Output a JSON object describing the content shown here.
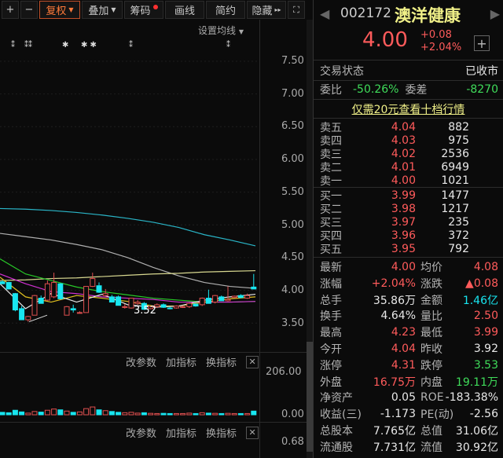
{
  "toolbar": {
    "plus": "+",
    "minus": "−",
    "fuquan": "复权",
    "diejia": "叠加",
    "chouma": "筹码",
    "huaxian": "画线",
    "jianyue": "简约",
    "yincang": "隐藏",
    "set_ma": "设置均线"
  },
  "price_axis": [
    "7.50",
    "7.00",
    "6.50",
    "6.00",
    "5.50",
    "5.00",
    "4.50",
    "4.00",
    "3.50"
  ],
  "low_marker": "3.52",
  "indicator_bar": {
    "change_params": "改参数",
    "add_indicator": "加指标",
    "switch_indicator": "换指标",
    "close": "✕"
  },
  "volume_axis": [
    "206.00",
    "0.00"
  ],
  "third_axis": [
    "0.68"
  ],
  "candles": [
    [
      4.13,
      4.15,
      4.1,
      4.1
    ],
    [
      4.12,
      4.13,
      4.02,
      4.02
    ],
    [
      3.95,
      3.96,
      3.68,
      3.7
    ],
    [
      3.72,
      3.76,
      3.55,
      3.55
    ],
    [
      3.55,
      3.61,
      3.52,
      3.6
    ],
    [
      3.62,
      3.93,
      3.62,
      3.92
    ],
    [
      3.88,
      3.92,
      3.8,
      3.8
    ],
    [
      3.85,
      4.15,
      3.84,
      4.1
    ],
    [
      3.9,
      4.27,
      3.88,
      4.12
    ],
    [
      4.1,
      4.11,
      3.86,
      3.87
    ],
    [
      3.62,
      3.76,
      3.62,
      3.75
    ],
    [
      3.72,
      3.78,
      3.66,
      3.7
    ],
    [
      3.66,
      3.68,
      3.65,
      3.66
    ],
    [
      3.66,
      4.06,
      3.66,
      4.06
    ],
    [
      4.06,
      4.27,
      4.05,
      4.18
    ],
    [
      4.07,
      4.12,
      3.96,
      3.97
    ],
    [
      3.92,
      4.02,
      3.9,
      3.95
    ],
    [
      3.9,
      3.93,
      3.82,
      3.82
    ],
    [
      3.9,
      3.92,
      3.77,
      3.77
    ],
    [
      3.75,
      3.79,
      3.72,
      3.75
    ],
    [
      3.73,
      3.88,
      3.72,
      3.88
    ],
    [
      3.8,
      3.85,
      3.78,
      3.82
    ],
    [
      3.8,
      3.82,
      3.7,
      3.71
    ],
    [
      3.72,
      3.76,
      3.71,
      3.75
    ],
    [
      3.75,
      3.8,
      3.73,
      3.78
    ],
    [
      3.78,
      3.8,
      3.73,
      3.74
    ],
    [
      3.73,
      3.75,
      3.71,
      3.72
    ],
    [
      3.73,
      3.77,
      3.72,
      3.76
    ],
    [
      3.74,
      3.77,
      3.73,
      3.75
    ],
    [
      3.75,
      3.81,
      3.73,
      3.8
    ],
    [
      3.79,
      3.8,
      3.75,
      3.76
    ],
    [
      3.78,
      3.89,
      3.76,
      3.88
    ],
    [
      3.88,
      4.01,
      3.8,
      3.8
    ],
    [
      3.82,
      3.93,
      3.8,
      3.92
    ],
    [
      3.9,
      3.92,
      3.84,
      3.84
    ],
    [
      3.84,
      4.06,
      3.83,
      3.86
    ],
    [
      3.89,
      3.92,
      3.88,
      3.91
    ],
    [
      3.92,
      3.94,
      3.88,
      3.89
    ],
    [
      3.88,
      3.95,
      3.87,
      3.92
    ],
    [
      4.05,
      4.25,
      4.02,
      4.02
    ]
  ],
  "ma_lines": [
    {
      "color": "#2ab6c8",
      "values": [
        5.25,
        5.24,
        5.22,
        5.19,
        5.15,
        5.1,
        5.04,
        4.96,
        4.85,
        4.77,
        4.68
      ]
    },
    {
      "color": "#b0b0b0",
      "values": [
        4.87,
        4.82,
        4.77,
        4.7,
        4.62,
        4.5,
        4.35,
        4.22,
        4.12,
        4.06,
        4.03
      ]
    },
    {
      "color": "#d8d890",
      "values": [
        4.15,
        4.16,
        4.18,
        4.19,
        4.21,
        4.23,
        4.25,
        4.26,
        4.28,
        4.29,
        4.3
      ]
    },
    {
      "color": "#28c828",
      "values": [
        4.48,
        4.25,
        4.15,
        4.05,
        3.98,
        3.93,
        3.88,
        3.85,
        3.82,
        3.82,
        3.83
      ]
    },
    {
      "color": "#d030d0",
      "values": [
        4.25,
        4.1,
        3.98,
        3.95,
        3.9,
        3.88,
        3.86,
        3.82,
        3.82,
        3.82,
        3.83
      ]
    },
    {
      "color": "#e0c020",
      "values": [
        4.2,
        3.9,
        3.82,
        3.92,
        3.88,
        3.83,
        3.76,
        3.76,
        3.82,
        3.87,
        3.9
      ]
    },
    {
      "color": "#e8e8e8",
      "values": [
        4.1,
        3.72,
        3.95,
        3.82,
        3.94,
        3.78,
        3.74,
        3.76,
        3.85,
        3.9,
        3.94
      ]
    }
  ],
  "volumes": [
    12,
    10,
    22,
    14,
    8,
    16,
    13,
    22,
    28,
    24,
    18,
    12,
    14,
    30,
    38,
    24,
    20,
    16,
    12,
    10,
    12,
    8,
    10,
    7,
    6,
    7,
    6,
    6,
    6,
    8,
    6,
    10,
    8,
    7,
    6,
    7,
    6,
    6,
    6,
    18
  ],
  "colors": {
    "up": "#e05050",
    "down": "#18e6f0",
    "bg": "#0b0b0b"
  },
  "quote": {
    "code": "002172",
    "name": "澳洋健康",
    "price": "4.00",
    "change": "+0.08",
    "change_pct": "+2.04%",
    "add": "+"
  },
  "status": {
    "label": "交易状态",
    "value": "已收市"
  },
  "weibi": {
    "label": "委比",
    "value": "-50.26%",
    "label2": "委差",
    "value2": "-8270"
  },
  "promo": "仅需20元查看十档行情",
  "asks": [
    {
      "label": "卖五",
      "price": "4.04",
      "vol": "882"
    },
    {
      "label": "卖四",
      "price": "4.03",
      "vol": "975"
    },
    {
      "label": "卖三",
      "price": "4.02",
      "vol": "2536"
    },
    {
      "label": "卖二",
      "price": "4.01",
      "vol": "6949"
    },
    {
      "label": "卖一",
      "price": "4.00",
      "vol": "1021"
    }
  ],
  "bids": [
    {
      "label": "买一",
      "price": "3.99",
      "vol": "1477"
    },
    {
      "label": "买二",
      "price": "3.98",
      "vol": "1217"
    },
    {
      "label": "买三",
      "price": "3.97",
      "vol": "235"
    },
    {
      "label": "买四",
      "price": "3.96",
      "vol": "372"
    },
    {
      "label": "买五",
      "price": "3.95",
      "vol": "792"
    }
  ],
  "stats": [
    {
      "l1": "最新",
      "v1": "4.00",
      "c1": "red",
      "l2": "均价",
      "v2": "4.08",
      "c2": "red"
    },
    {
      "l1": "涨幅",
      "v1": "+2.04%",
      "c1": "red",
      "l2": "涨跌",
      "v2": "▲0.08",
      "c2": "red"
    },
    {
      "l1": "总手",
      "v1": "35.86万",
      "c1": "white",
      "l2": "金额",
      "v2": "1.46亿",
      "c2": "cyan"
    },
    {
      "l1": "换手",
      "v1": "4.64%",
      "c1": "white",
      "l2": "量比",
      "v2": "2.50",
      "c2": "red"
    },
    {
      "l1": "最高",
      "v1": "4.23",
      "c1": "red",
      "l2": "最低",
      "v2": "3.99",
      "c2": "red"
    },
    {
      "l1": "今开",
      "v1": "4.04",
      "c1": "red",
      "l2": "昨收",
      "v2": "3.92",
      "c2": "white"
    },
    {
      "l1": "涨停",
      "v1": "4.31",
      "c1": "red",
      "l2": "跌停",
      "v2": "3.53",
      "c2": "green"
    },
    {
      "l1": "外盘",
      "v1": "16.75万",
      "c1": "red",
      "l2": "内盘",
      "v2": "19.11万",
      "c2": "green"
    },
    {
      "l1": "净资产",
      "v1": "0.05",
      "c1": "white",
      "l2": "ROE",
      "v2": "-183.38%",
      "c2": "white"
    },
    {
      "l1": "收益(三)",
      "v1": "-1.173",
      "c1": "white",
      "l2": "PE(动)",
      "v2": "-2.56",
      "c2": "white"
    },
    {
      "l1": "总股本",
      "v1": "7.765亿",
      "c1": "white",
      "l2": "总值",
      "v2": "31.06亿",
      "c2": "white"
    },
    {
      "l1": "流通股",
      "v1": "7.731亿",
      "c1": "white",
      "l2": "流值",
      "v2": "30.92亿",
      "c2": "white"
    }
  ]
}
